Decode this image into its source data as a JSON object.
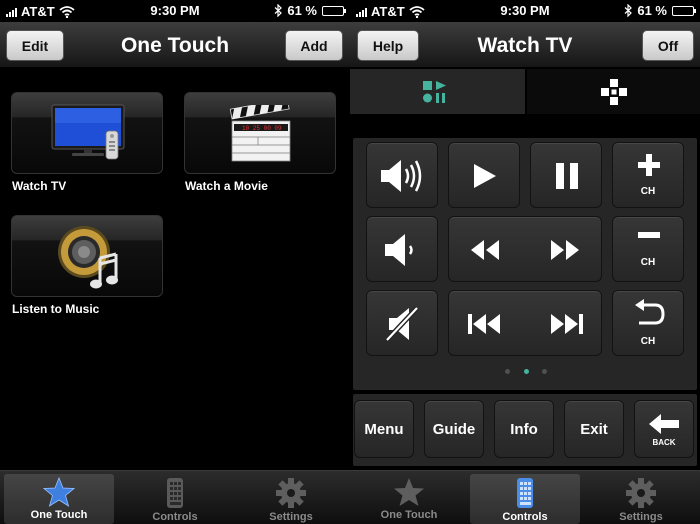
{
  "status_left": {
    "carrier": "AT&T",
    "time": "9:30 PM",
    "battery": "61 %",
    "battery_level": 0.61
  },
  "status_right": {
    "carrier": "AT&T",
    "time": "9:30 PM",
    "battery": "61 %",
    "battery_level": 0.61
  },
  "one_touch": {
    "title": "One Touch",
    "edit_label": "Edit",
    "add_label": "Add",
    "tiles": [
      {
        "label": "Watch TV",
        "icon": "tv-icon"
      },
      {
        "label": "Watch a Movie",
        "icon": "clapperboard-icon"
      },
      {
        "label": "Listen to Music",
        "icon": "music-icon"
      }
    ]
  },
  "watch_tv": {
    "title": "Watch TV",
    "help_label": "Help",
    "off_label": "Off",
    "segments": [
      {
        "icon": "media-controls-icon",
        "selected": true
      },
      {
        "icon": "dpad-icon",
        "selected": false
      }
    ],
    "ch_up_label": "CH",
    "ch_down_label": "CH",
    "ch_back_label": "CH",
    "page_dots": {
      "count": 3,
      "active": 1
    },
    "function_buttons": [
      "Menu",
      "Guide",
      "Info",
      "Exit"
    ],
    "back_label": "BACK"
  },
  "tabbar_left": {
    "tabs": [
      {
        "label": "One Touch",
        "icon": "star-icon",
        "active": true
      },
      {
        "label": "Controls",
        "icon": "remote-icon",
        "active": false
      },
      {
        "label": "Settings",
        "icon": "gear-icon",
        "active": false
      }
    ]
  },
  "tabbar_right": {
    "tabs": [
      {
        "label": "One Touch",
        "icon": "star-icon",
        "active": false
      },
      {
        "label": "Controls",
        "icon": "remote-icon",
        "active": true
      },
      {
        "label": "Settings",
        "icon": "gear-icon",
        "active": false
      }
    ]
  },
  "colors": {
    "accent": "#45b39d",
    "star_active": "#3f7fe0",
    "panel": "#262626"
  }
}
